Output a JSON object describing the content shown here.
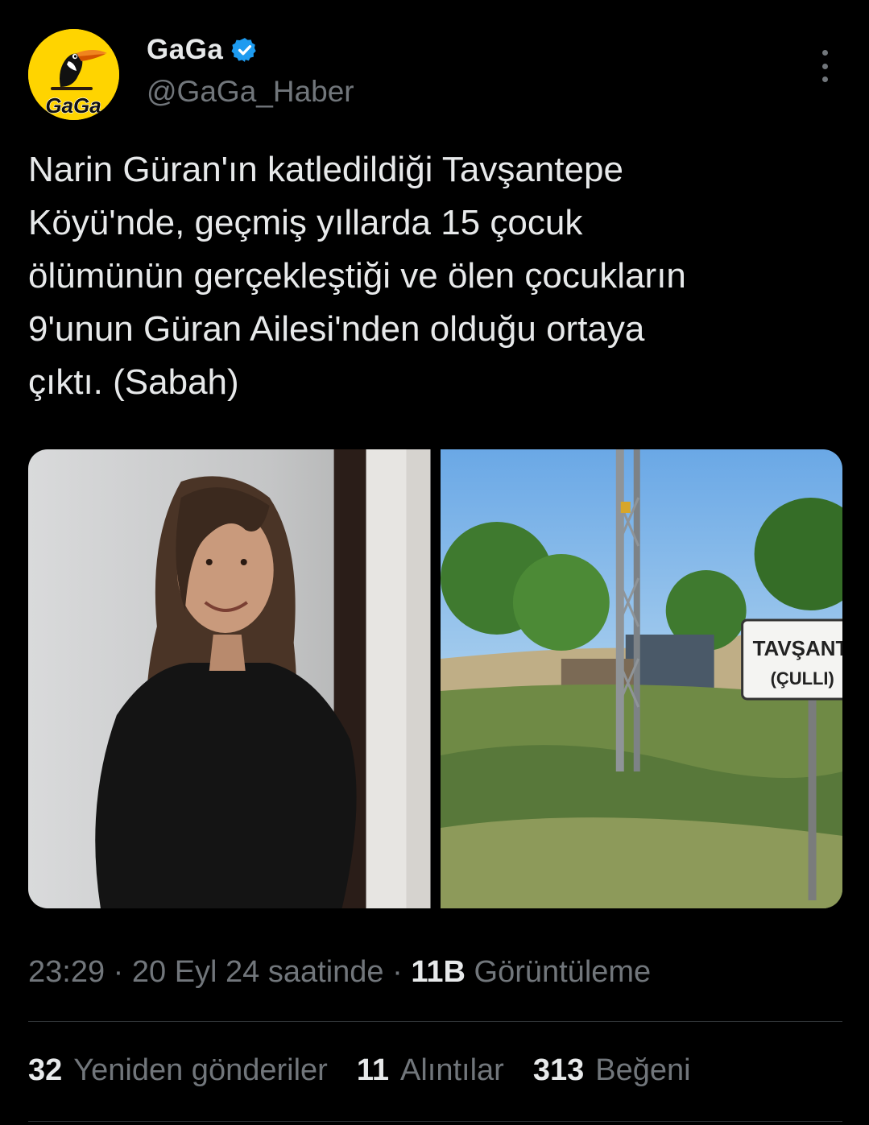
{
  "author": {
    "display_name": "GaGa",
    "handle": "@GaGa_Haber",
    "avatar_text": "GaGa",
    "verified": true
  },
  "tweet": {
    "text_lines": [
      "Narin Güran'ın katledildiği Tavşantepe",
      "Köyü'nde, geçmiş yıllarda 15 çocuk",
      "ölümünün gerçekleştiği ve ölen çocukların",
      "9'unun Güran Ailesi'nden olduğu ortaya",
      "çıktı. (Sabah)"
    ],
    "photos": [
      {
        "icon": "portrait-photo"
      },
      {
        "icon": "village-sign-photo",
        "sign_line1": "TAVŞANTEP",
        "sign_line2": "(ÇULLI)"
      }
    ]
  },
  "meta": {
    "time": "23:29",
    "sep": " · ",
    "date": "20 Eyl 24 saatinde",
    "views_count": "11B",
    "views_label": "Görüntüleme"
  },
  "stats": {
    "retweets_count": "32",
    "retweets_label": "Yeniden gönderiler",
    "quotes_count": "11",
    "quotes_label": "Alıntılar",
    "likes_count": "313",
    "likes_label": "Beğeni"
  },
  "colors": {
    "background": "#000000",
    "text_primary": "#e7e9ea",
    "text_secondary": "#71767b",
    "verified_blue": "#1d9bf0",
    "avatar_yellow": "#ffd400"
  }
}
